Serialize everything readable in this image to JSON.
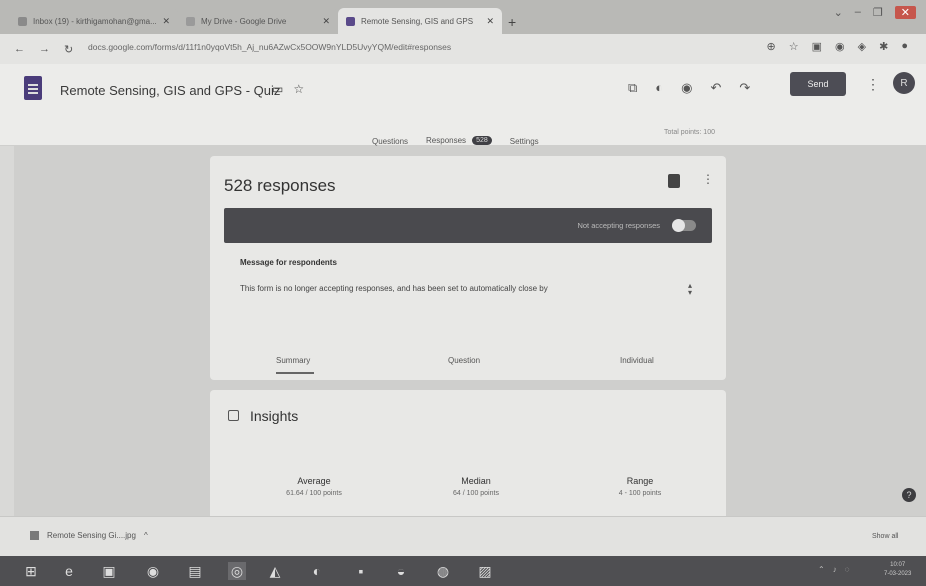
{
  "browser": {
    "tabs": [
      {
        "label": "Inbox (19) - kirthigamohan@gma...",
        "active": false,
        "fav_color": "#8a8a8a"
      },
      {
        "label": "My Drive - Google Drive",
        "active": false,
        "fav_color": "#9a9a9a"
      },
      {
        "label": "Remote Sensing, GIS and GPS",
        "active": true,
        "fav_color": "#5a4a8a"
      }
    ],
    "new_tab": "+",
    "url": "docs.google.com/forms/d/11f1n0yqoVt5h_Aj_nu6AZwCx5OOW9nYLD5UvyYQM/edit#responses"
  },
  "form": {
    "title": "Remote Sensing, GIS and GPS - Quiz",
    "send_label": "Send",
    "avatar_initial": "R",
    "tabs": {
      "questions": "Questions",
      "responses": "Responses",
      "responses_count": "528",
      "settings": "Settings"
    },
    "total_points": "Total points: 100"
  },
  "responses_card": {
    "title": "528 responses",
    "accepting_label": "Not accepting responses",
    "message_label": "Message for respondents",
    "message_text": "This form is no longer accepting responses, and has been set to automatically close by",
    "subtabs": {
      "summary": "Summary",
      "question": "Question",
      "individual": "Individual"
    }
  },
  "insights": {
    "title": "Insights",
    "stats": [
      {
        "label": "Average",
        "value": "61.64 / 100 points"
      },
      {
        "label": "Median",
        "value": "64 / 100 points"
      },
      {
        "label": "Range",
        "value": "4 - 100 points"
      }
    ]
  },
  "download": {
    "filename": "Remote Sensing Gi....jpg",
    "show_all": "Show all"
  },
  "taskbar": {
    "time": "10:07",
    "date": "7-03-2023"
  }
}
